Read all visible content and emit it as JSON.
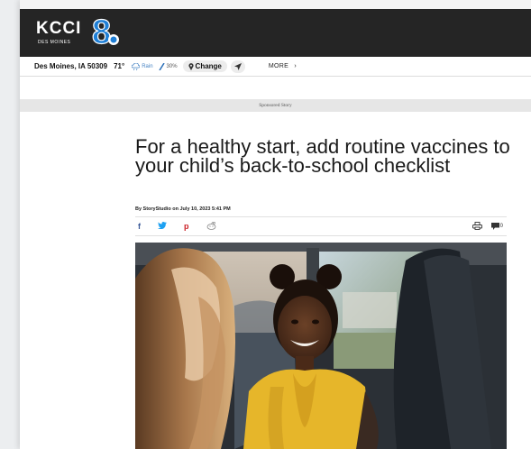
{
  "header": {
    "logo_text": "KCCI",
    "logo_sub": "DES MOINES",
    "logo_number": "8"
  },
  "weather": {
    "location": "Des Moines, IA 50309",
    "temp": "71°",
    "condition": "Rain",
    "precip": "30%",
    "change_label": "Change",
    "more_label": "MORE"
  },
  "ad": {
    "label": "Sponsored Story"
  },
  "article": {
    "title": "For a healthy start, add routine vaccines to your child’s back-to-school checklist",
    "byline": "By StoryStudio on July 10, 2023 5:41 PM",
    "comment_count": "0"
  },
  "share": {
    "facebook": "f",
    "twitter": "t",
    "pinterest": "p",
    "reddit": "r"
  },
  "colors": {
    "header_bg": "#252525",
    "accent_blue": "#1f7fd6",
    "facebook": "#3b5998",
    "twitter": "#1da1f2",
    "pinterest": "#cb2027"
  },
  "icons": [
    "rain-icon",
    "precip-icon",
    "location-pin-icon",
    "locate-arrow-icon",
    "chevron-right-icon",
    "facebook-icon",
    "twitter-icon",
    "pinterest-icon",
    "reddit-icon",
    "print-icon",
    "comment-icon"
  ]
}
